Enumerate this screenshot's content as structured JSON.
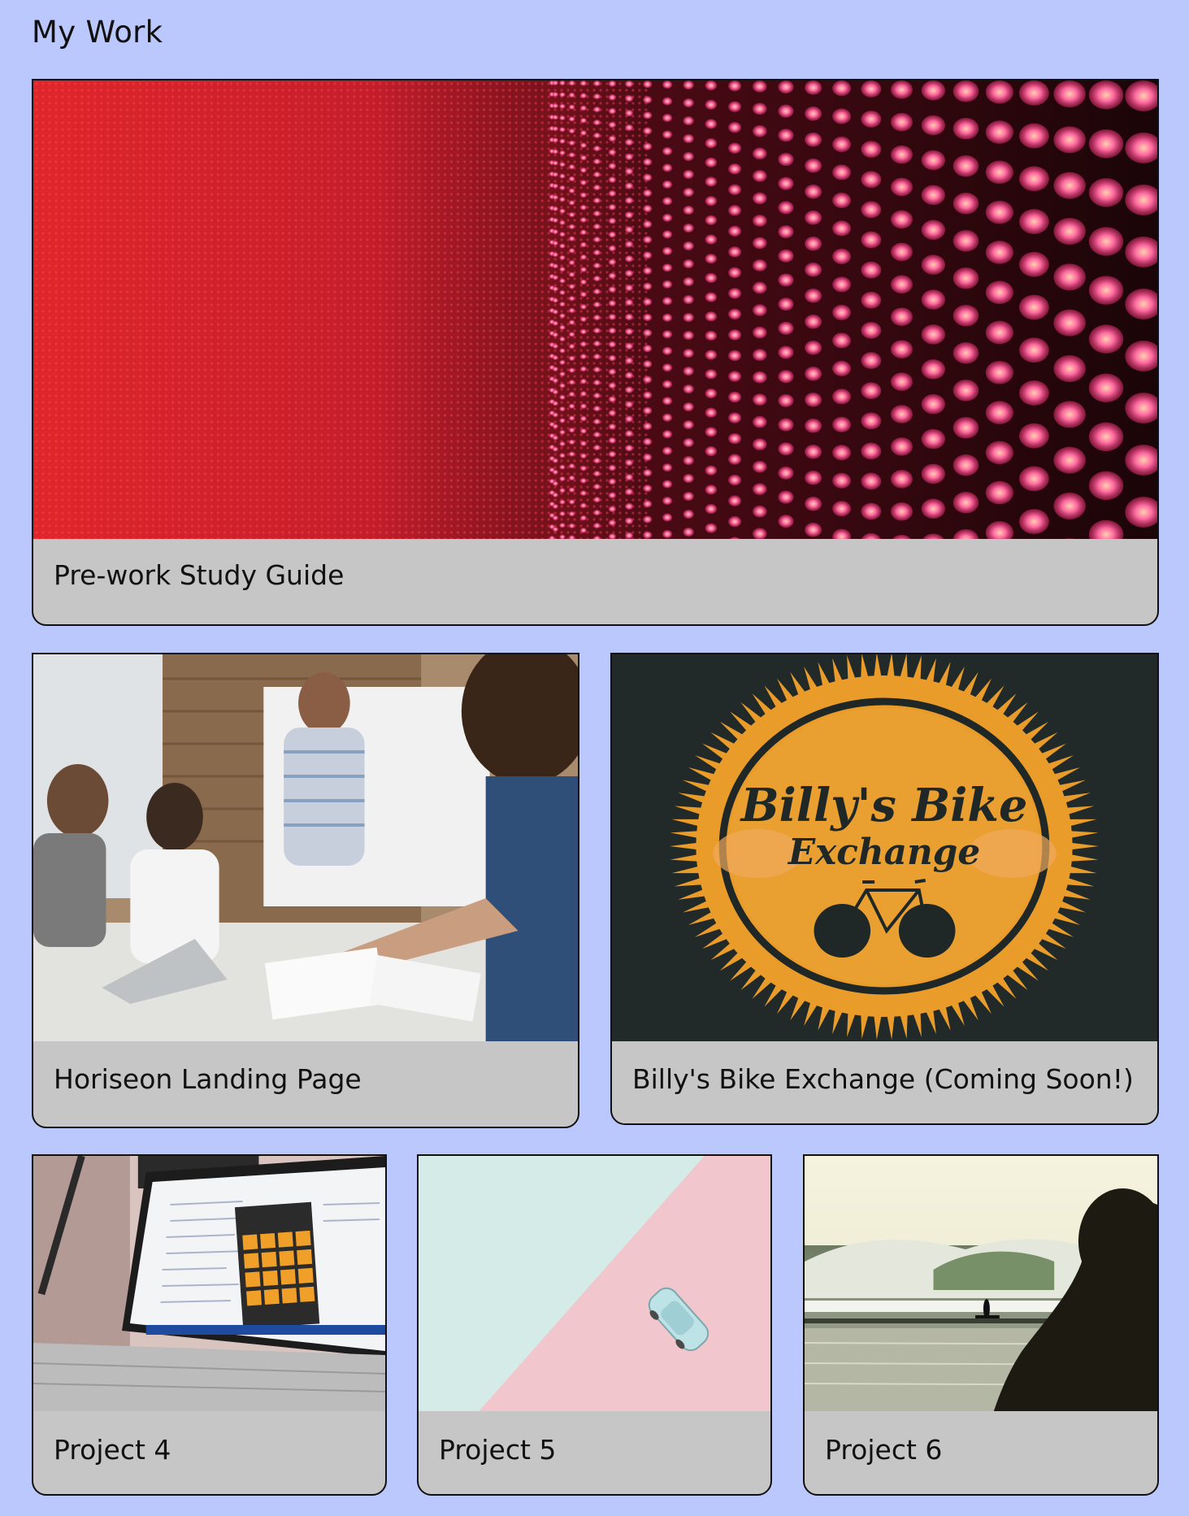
{
  "page": {
    "title": "My Work"
  },
  "cards": [
    {
      "label": "Pre-work Study Guide",
      "image": "led-wall-image"
    },
    {
      "label": "Horiseon Landing Page",
      "image": "team-meeting-image"
    },
    {
      "label": "Billy's Bike Exchange (Coming Soon!)",
      "image": "bike-exchange-logo",
      "logo_line1": "Billy's Bike",
      "logo_line2": "Exchange"
    },
    {
      "label": "Project 4",
      "image": "laptop-calculator-image"
    },
    {
      "label": "Project 5",
      "image": "toy-car-image"
    },
    {
      "label": "Project 6",
      "image": "surfer-image"
    }
  ],
  "colors": {
    "background": "#bac8fd",
    "card": "#c6c6c6",
    "border": "#111111"
  }
}
